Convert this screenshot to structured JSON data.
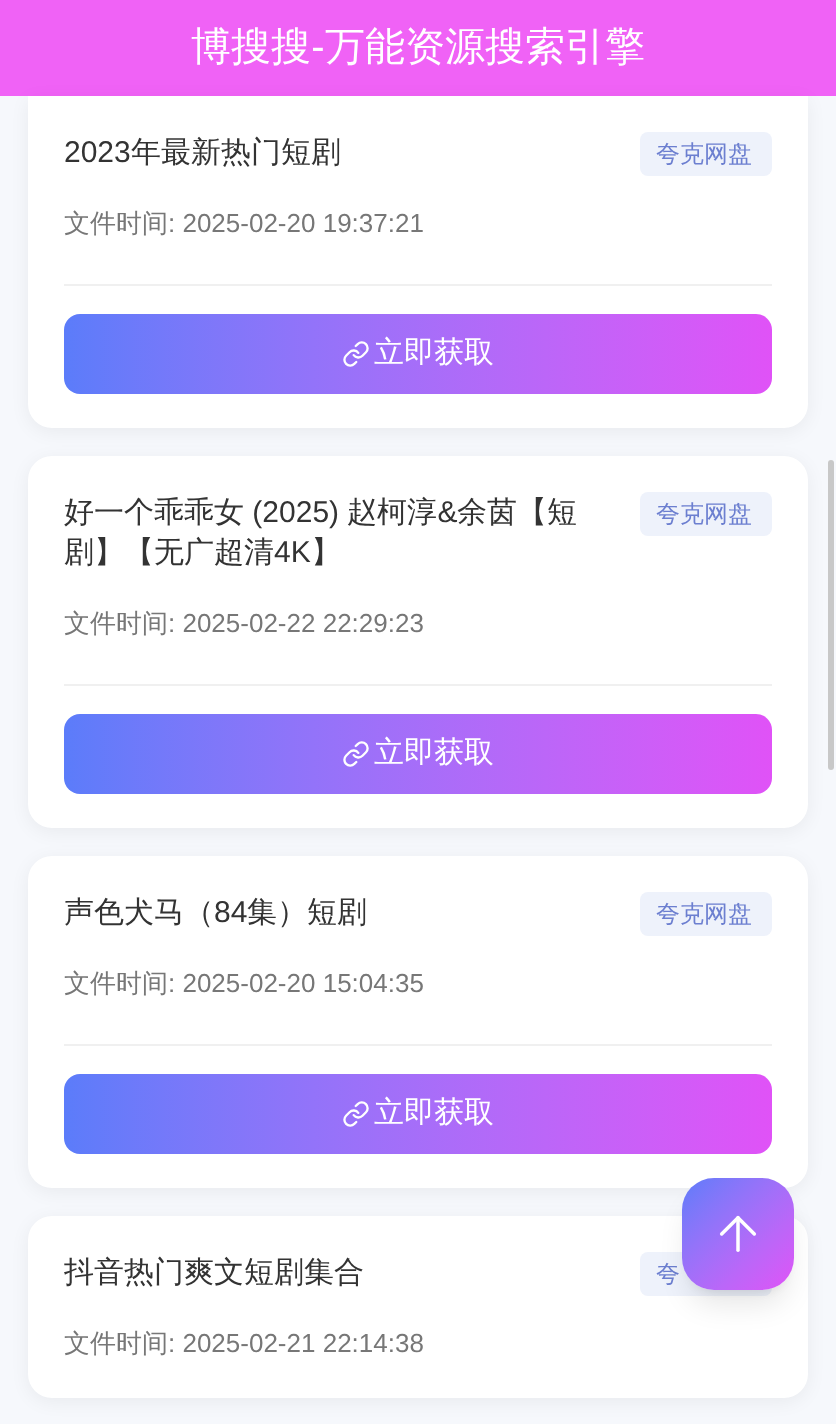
{
  "header": {
    "title": "博搜搜-万能资源搜索引擎"
  },
  "cards": [
    {
      "title": "2023年最新热门短剧",
      "tag": "夸克网盘",
      "time": "文件时间: 2025-02-20 19:37:21",
      "button": "立即获取"
    },
    {
      "title": "好一个乖乖女 (2025) 赵柯淳&余茵【短剧】【无广超清4K】",
      "tag": "夸克网盘",
      "time": "文件时间: 2025-02-22 22:29:23",
      "button": "立即获取"
    },
    {
      "title": "声色犬马（84集）短剧",
      "tag": "夸克网盘",
      "time": "文件时间: 2025-02-20 15:04:35",
      "button": "立即获取"
    },
    {
      "title": "抖音热门爽文短剧集合",
      "tag": "夸",
      "time": "文件时间: 2025-02-21 22:14:38"
    }
  ]
}
